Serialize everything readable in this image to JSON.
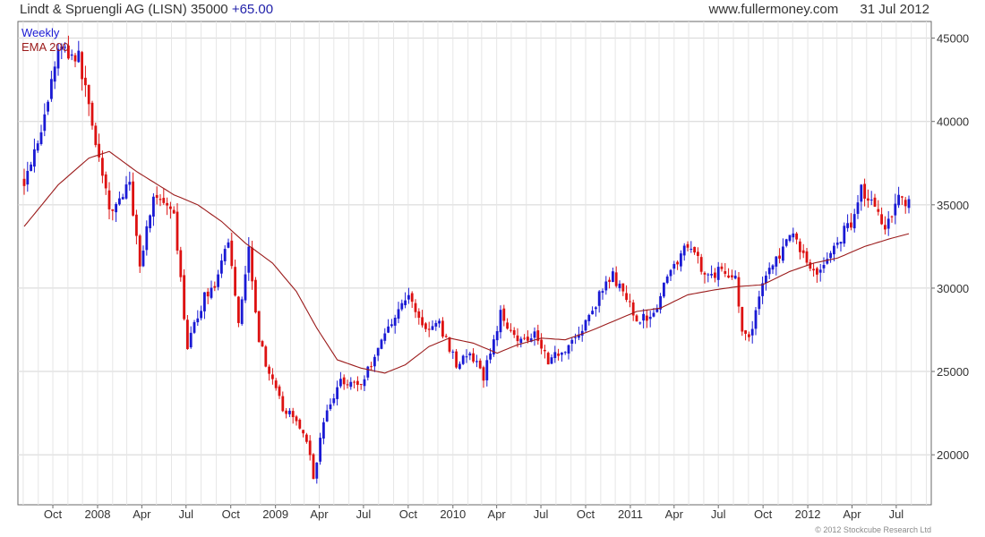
{
  "header": {
    "title": "Lindt & Spruengli AG (LISN) 35000",
    "change": "+65.00",
    "site": "www.fullermoney.com",
    "date": "31 Jul 2012"
  },
  "legend": {
    "period": "Weekly",
    "ema": "EMA 200"
  },
  "copyright": "© 2012 Stockcube Research Ltd",
  "colors": {
    "up": "#1a1ad4",
    "down": "#dd1111",
    "ema": "#9b1b1b",
    "grid": "#d4d4d4"
  },
  "chart_data": {
    "type": "candlestick",
    "frequency": "weekly",
    "ylim": [
      17000,
      46000
    ],
    "y_ticks": [
      20000,
      25000,
      30000,
      35000,
      40000,
      45000
    ],
    "y_tick_labels": [
      "20000",
      "25000",
      "30000",
      "35000",
      "40000",
      "45000"
    ],
    "x_tick_labels": [
      "Oct",
      "2008",
      "Apr",
      "Jul",
      "Oct",
      "2009",
      "Apr",
      "Jul",
      "Oct",
      "2010",
      "Apr",
      "Jul",
      "Oct",
      "2011",
      "Apr",
      "Jul",
      "Oct",
      "2012",
      "Apr",
      "Jul"
    ],
    "grid": true,
    "weekly_close": {
      "start": "2007-08-03",
      "anchors": [
        [
          "2007-08-03",
          36500
        ],
        [
          "2007-09-14",
          40200
        ],
        [
          "2007-10-12",
          44500
        ],
        [
          "2007-11-23",
          43800
        ],
        [
          "2007-12-14",
          41000
        ],
        [
          "2008-01-04",
          37800
        ],
        [
          "2008-01-25",
          34500
        ],
        [
          "2008-03-07",
          36200
        ],
        [
          "2008-03-28",
          31500
        ],
        [
          "2008-04-25",
          35600
        ],
        [
          "2008-06-06",
          34200
        ],
        [
          "2008-07-04",
          26500
        ],
        [
          "2008-08-08",
          29500
        ],
        [
          "2008-09-05",
          30500
        ],
        [
          "2008-09-26",
          33000
        ],
        [
          "2008-10-17",
          28000
        ],
        [
          "2008-11-07",
          32500
        ],
        [
          "2008-11-28",
          27000
        ],
        [
          "2008-12-19",
          24800
        ],
        [
          "2009-01-16",
          22800
        ],
        [
          "2009-02-13",
          22000
        ],
        [
          "2009-03-06",
          21000
        ],
        [
          "2009-03-20",
          18600
        ],
        [
          "2009-04-10",
          22000
        ],
        [
          "2009-05-15",
          24500
        ],
        [
          "2009-06-26",
          24200
        ],
        [
          "2009-08-14",
          27300
        ],
        [
          "2009-09-11",
          28800
        ],
        [
          "2009-10-02",
          29500
        ],
        [
          "2009-11-06",
          27500
        ],
        [
          "2009-12-04",
          27800
        ],
        [
          "2010-01-08",
          25500
        ],
        [
          "2010-02-05",
          26000
        ],
        [
          "2010-03-05",
          24700
        ],
        [
          "2010-04-09",
          28400
        ],
        [
          "2010-05-21",
          26800
        ],
        [
          "2010-06-18",
          27400
        ],
        [
          "2010-07-16",
          25700
        ],
        [
          "2010-08-20",
          26400
        ],
        [
          "2010-09-24",
          27500
        ],
        [
          "2010-10-29",
          29500
        ],
        [
          "2010-11-26",
          30800
        ],
        [
          "2010-12-24",
          29200
        ],
        [
          "2011-01-21",
          28000
        ],
        [
          "2011-02-18",
          28600
        ],
        [
          "2011-04-01",
          31500
        ],
        [
          "2011-05-06",
          32700
        ],
        [
          "2011-06-03",
          30800
        ],
        [
          "2011-07-08",
          31000
        ],
        [
          "2011-08-05",
          30800
        ],
        [
          "2011-08-19",
          27200
        ],
        [
          "2011-09-02",
          26800
        ],
        [
          "2011-09-30",
          30500
        ],
        [
          "2011-11-04",
          32000
        ],
        [
          "2011-12-02",
          33200
        ],
        [
          "2012-01-06",
          31200
        ],
        [
          "2012-01-27",
          31000
        ],
        [
          "2012-03-02",
          32800
        ],
        [
          "2012-03-30",
          34000
        ],
        [
          "2012-04-20",
          36000
        ],
        [
          "2012-05-18",
          34800
        ],
        [
          "2012-06-08",
          33800
        ],
        [
          "2012-07-06",
          35500
        ],
        [
          "2012-07-31",
          35000
        ]
      ]
    },
    "ema200": {
      "anchors": [
        [
          "2007-08-03",
          33700
        ],
        [
          "2007-10-12",
          36200
        ],
        [
          "2007-12-14",
          37800
        ],
        [
          "2008-01-25",
          38200
        ],
        [
          "2008-03-21",
          37000
        ],
        [
          "2008-06-06",
          35600
        ],
        [
          "2008-07-25",
          35000
        ],
        [
          "2008-09-12",
          34000
        ],
        [
          "2008-10-31",
          32700
        ],
        [
          "2008-12-26",
          31500
        ],
        [
          "2009-02-13",
          29800
        ],
        [
          "2009-03-27",
          27600
        ],
        [
          "2009-05-08",
          25700
        ],
        [
          "2009-06-26",
          25200
        ],
        [
          "2009-08-14",
          24900
        ],
        [
          "2009-09-25",
          25400
        ],
        [
          "2009-11-13",
          26500
        ],
        [
          "2009-12-25",
          27000
        ],
        [
          "2010-02-12",
          26700
        ],
        [
          "2010-04-02",
          26100
        ],
        [
          "2010-05-14",
          26600
        ],
        [
          "2010-07-02",
          27000
        ],
        [
          "2010-08-20",
          26900
        ],
        [
          "2010-10-08",
          27400
        ],
        [
          "2010-11-26",
          28000
        ],
        [
          "2011-01-14",
          28600
        ],
        [
          "2011-03-04",
          28800
        ],
        [
          "2011-04-29",
          29600
        ],
        [
          "2011-06-24",
          29900
        ],
        [
          "2011-08-12",
          30100
        ],
        [
          "2011-09-30",
          30200
        ],
        [
          "2011-11-25",
          31000
        ],
        [
          "2012-01-13",
          31500
        ],
        [
          "2012-03-02",
          31800
        ],
        [
          "2012-04-27",
          32500
        ],
        [
          "2012-06-22",
          33000
        ],
        [
          "2012-07-31",
          33300
        ]
      ]
    }
  }
}
